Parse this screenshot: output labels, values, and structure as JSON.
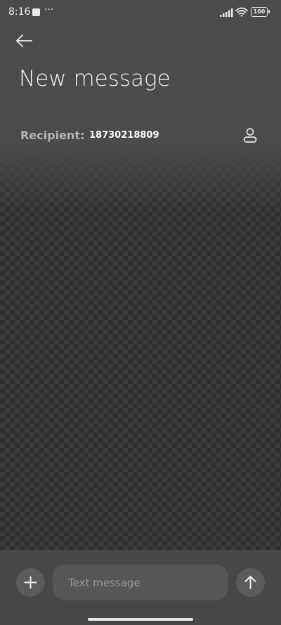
{
  "status_bar": {
    "time": "8:16",
    "overflow_indicator": "···",
    "battery_level": "100",
    "icons": [
      "notification-square-icon",
      "signal-icon",
      "wifi-icon",
      "battery-icon"
    ]
  },
  "header": {
    "back_icon": "arrow-left-icon",
    "title": "New message"
  },
  "recipient": {
    "label": "Recipient:",
    "value": "18730218809",
    "contact_icon": "person-icon"
  },
  "composer": {
    "attach_icon": "plus-icon",
    "placeholder": "Text message",
    "value": "",
    "send_icon": "arrow-up-icon"
  },
  "colors": {
    "header_background": "#4b4b4b",
    "composer_background": "#474747",
    "button_background": "#5b5b5b",
    "label_gray": "#b4b4b4",
    "text_white": "#ffffff"
  }
}
